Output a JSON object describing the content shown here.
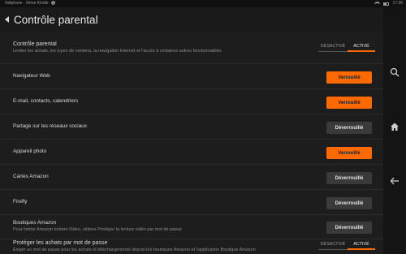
{
  "statusbar": {
    "left_text": "Stéphane - 2ème Kindle",
    "info_glyph": "i",
    "time": "17:36"
  },
  "header": {
    "title": "Contrôle parental"
  },
  "rows": [
    {
      "label": "Contrôle parental",
      "sub": "Limiter les achats, les types de contenu, la navigation Internet et l'accès à certaines autres fonctionnalités",
      "type": "toggle",
      "off_label": "DÉSACTIVÉ",
      "on_label": "ACTIVÉ"
    },
    {
      "label": "Navigateur Web",
      "type": "button",
      "state": "locked",
      "button_label": "Verrouillé"
    },
    {
      "label": "E-mail, contacts, calendriers",
      "type": "button",
      "state": "locked",
      "button_label": "Verrouillé"
    },
    {
      "label": "Partage sur les réseaux sociaux",
      "type": "button",
      "state": "unlocked",
      "button_label": "Déverrouillé"
    },
    {
      "label": "Appareil photo",
      "type": "button",
      "state": "locked",
      "button_label": "Verrouillé"
    },
    {
      "label": "Cartes Amazon",
      "type": "button",
      "state": "unlocked",
      "button_label": "Déverrouillé"
    },
    {
      "label": "Firefly",
      "type": "button",
      "state": "unlocked",
      "button_label": "Déverrouillé"
    },
    {
      "label": "Boutiques Amazon",
      "sub": "Pour limiter Amazon Instant Video, utilisez Protéger la lecture vidéo par mot de passe",
      "type": "button",
      "state": "unlocked",
      "button_label": "Déverrouillé"
    },
    {
      "label": "Protéger les achats par mot de passe",
      "sub": "Exiger un mot de passe pour les achats et téléchargements depuis les boutiques Amazon et l'application Boutique Amazon",
      "type": "toggle",
      "off_label": "DÉSACTIVÉ",
      "on_label": "ACTIVÉ"
    }
  ],
  "nav": {
    "search": "search-icon",
    "home": "home-icon",
    "back": "back-arrow-icon"
  },
  "colors": {
    "accent": "#ff6a00",
    "background": "#1d1d1d",
    "unlocked_button": "#3a3a3a"
  }
}
